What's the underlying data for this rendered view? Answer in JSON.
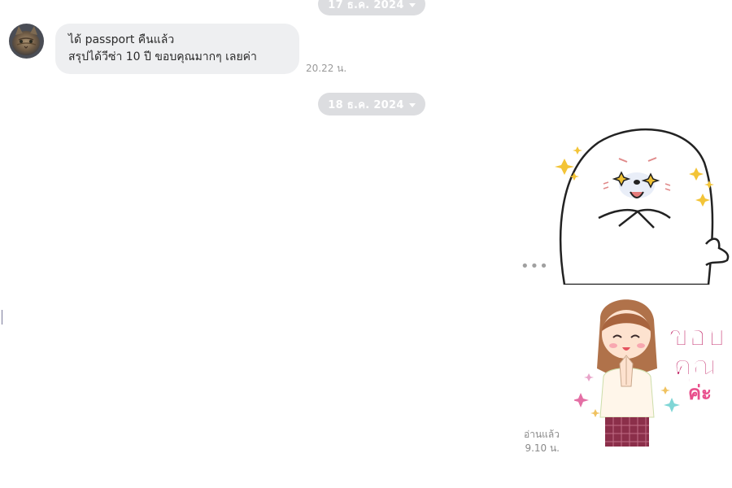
{
  "dates": [
    "17 ธ.ค. 2024",
    "18 ธ.ค. 2024"
  ],
  "incoming": {
    "lines": [
      "ได้ passport คืนแล้ว",
      "สรุปได้วีซ่า 10 ปี ขอบคุณมากๆ เลยค่า"
    ],
    "time": "20.22 น."
  },
  "more_label": "•••",
  "sticker2_text": [
    "ขอบ",
    "คุณ",
    "ค่ะ"
  ],
  "read_status": {
    "label": "อ่านแล้ว",
    "time": "9.10 น."
  },
  "icons": [
    "avatar-cat",
    "caret-down-icon",
    "more-options-icon"
  ],
  "colors": {
    "pill_bg": "#dcdde0",
    "bubble_bg": "#eeeff1",
    "sticker_text": "#c4306e"
  }
}
